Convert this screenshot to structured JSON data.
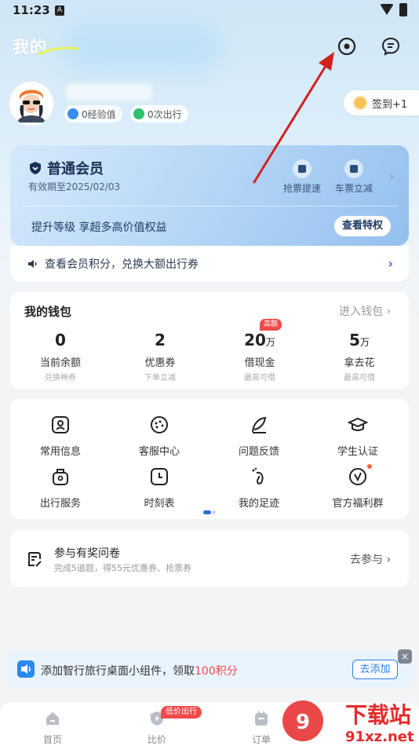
{
  "status_bar": {
    "time": "11:23",
    "notif_glyph": "A"
  },
  "header": {
    "title": "我的",
    "settings_icon": "settings-circle-icon",
    "message_icon": "message-icon"
  },
  "profile": {
    "experience": "0经验值",
    "trips": "0次出行",
    "checkin_label": "签到+1"
  },
  "member": {
    "level": "普通会员",
    "expiry": "有效期至2025/02/03",
    "perks": [
      {
        "label": "抢票提速",
        "icon": "rocket-icon"
      },
      {
        "label": "车票立减",
        "icon": "ticket-icon"
      }
    ],
    "promo": "提升等级 享超多高价值权益",
    "view_button": "查看特权",
    "points_text": "查看会员积分，兑换大额出行券"
  },
  "wallet": {
    "title": "我的钱包",
    "link": "进入钱包",
    "hot_badge": "高额",
    "items": [
      {
        "value": "0",
        "unit": "",
        "label": "当前余额",
        "sub": "兑换神券"
      },
      {
        "value": "2",
        "unit": "",
        "label": "优惠券",
        "sub": "下单立减"
      },
      {
        "value": "20",
        "unit": "万",
        "label": "借现金",
        "sub": "最高可借"
      },
      {
        "value": "5",
        "unit": "万",
        "label": "拿去花",
        "sub": "最高可借"
      }
    ]
  },
  "services": [
    {
      "label": "常用信息",
      "icon": "contact-card-icon"
    },
    {
      "label": "客服中心",
      "icon": "customer-service-icon"
    },
    {
      "label": "问题反馈",
      "icon": "feedback-icon"
    },
    {
      "label": "学生认证",
      "icon": "graduation-cap-icon"
    },
    {
      "label": "出行服务",
      "icon": "luggage-icon"
    },
    {
      "label": "时刻表",
      "icon": "clock-icon"
    },
    {
      "label": "我的足迹",
      "icon": "footprint-icon"
    },
    {
      "label": "官方福利群",
      "icon": "welfare-group-icon"
    }
  ],
  "survey": {
    "title": "参与有奖问卷",
    "subtitle": "完成5道题，得55元优惠券、抢票券",
    "link": "去参与"
  },
  "widget_banner": {
    "text_prefix": "添加智行旅行桌面小组件，领取",
    "highlight": "100积分",
    "button": "去添加",
    "close": "×"
  },
  "bottom_nav": [
    {
      "label": "首页",
      "icon": "home-icon"
    },
    {
      "label": "比价",
      "icon": "compare-icon",
      "badge": "低价出行"
    },
    {
      "label": "订单",
      "icon": "orders-icon"
    }
  ],
  "watermark": {
    "brand": "下载站",
    "domain": "91xz.net"
  },
  "colors": {
    "accent": "#2b7ee6",
    "alert": "#f04a4a",
    "arrow": "#d32020"
  }
}
